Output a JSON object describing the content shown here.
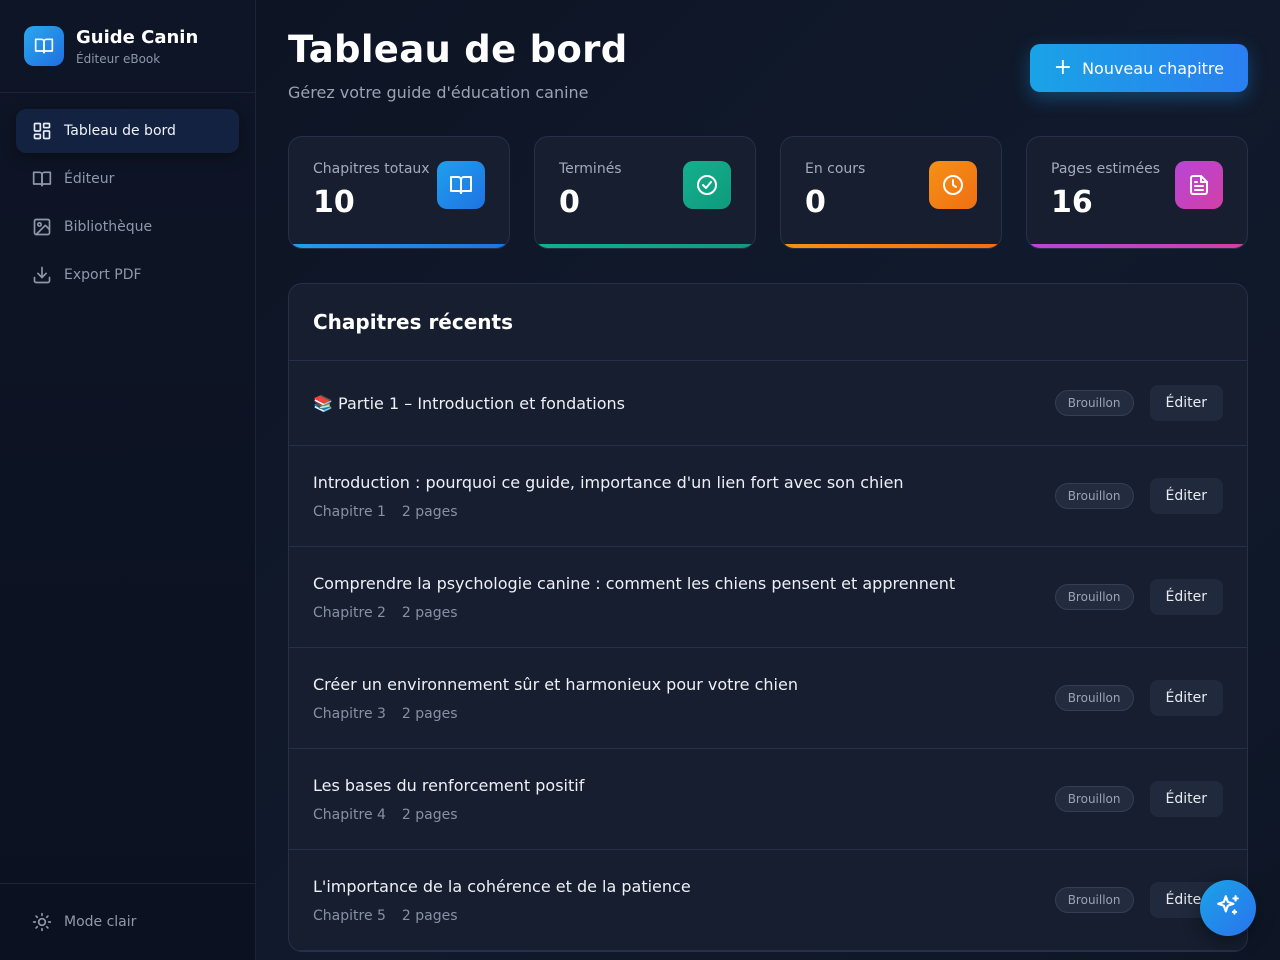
{
  "brand": {
    "title": "Guide Canin",
    "subtitle": "Éditeur eBook",
    "icon": "book-open-icon"
  },
  "sidebar": {
    "items": [
      {
        "label": "Tableau de bord",
        "icon": "dashboard-icon",
        "active": true
      },
      {
        "label": "Éditeur",
        "icon": "book-open-icon",
        "active": false
      },
      {
        "label": "Bibliothèque",
        "icon": "image-icon",
        "active": false
      },
      {
        "label": "Export PDF",
        "icon": "download-icon",
        "active": false
      }
    ],
    "footer": {
      "label": "Mode clair",
      "icon": "sun-icon"
    }
  },
  "header": {
    "title": "Tableau de bord",
    "subtitle": "Gérez votre guide d'éducation canine",
    "new_chapter_label": "Nouveau chapitre"
  },
  "stats": [
    {
      "label": "Chapitres totaux",
      "value": "10",
      "icon": "book-open-icon",
      "color": "#1f8fe8"
    },
    {
      "label": "Terminés",
      "value": "0",
      "icon": "check-circle-icon",
      "color": "#13a58a"
    },
    {
      "label": "En cours",
      "value": "0",
      "icon": "clock-icon",
      "color": "#f07f13"
    },
    {
      "label": "Pages estimées",
      "value": "16",
      "icon": "document-icon",
      "color": "#c13fc9"
    }
  ],
  "recent": {
    "title": "Chapitres récents",
    "status_label": "Brouillon",
    "edit_label": "Éditer",
    "rows": [
      {
        "title": "📚 Partie 1 – Introduction et fondations",
        "chapter": "",
        "pages": ""
      },
      {
        "title": "Introduction : pourquoi ce guide, importance d'un lien fort avec son chien",
        "chapter": "Chapitre 1",
        "pages": "2 pages"
      },
      {
        "title": "Comprendre la psychologie canine : comment les chiens pensent et apprennent",
        "chapter": "Chapitre 2",
        "pages": "2 pages"
      },
      {
        "title": "Créer un environnement sûr et harmonieux pour votre chien",
        "chapter": "Chapitre 3",
        "pages": "2 pages"
      },
      {
        "title": "Les bases du renforcement positif",
        "chapter": "Chapitre 4",
        "pages": "2 pages"
      },
      {
        "title": "L'importance de la cohérence et de la patience",
        "chapter": "Chapitre 5",
        "pages": "2 pages"
      }
    ]
  },
  "fab": {
    "icon": "sparkles-icon"
  }
}
